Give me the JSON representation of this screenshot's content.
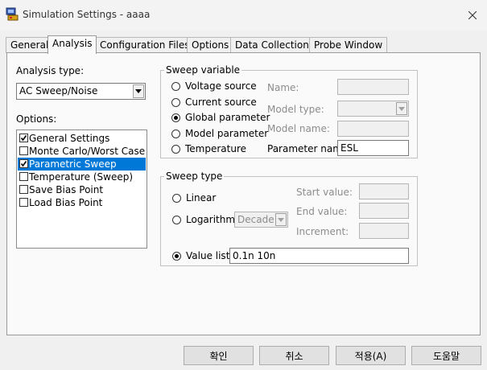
{
  "window": {
    "title": "Simulation Settings - aaaa"
  },
  "tabs": [
    {
      "label": "General"
    },
    {
      "label": "Analysis"
    },
    {
      "label": "Configuration Files"
    },
    {
      "label": "Options"
    },
    {
      "label": "Data Collection"
    },
    {
      "label": "Probe Window"
    }
  ],
  "analysis": {
    "type_label": "Analysis type:",
    "type_value": "AC Sweep/Noise",
    "options_label": "Options:",
    "options": [
      {
        "label": "General Settings",
        "checked": true
      },
      {
        "label": "Monte Carlo/Worst Case",
        "checked": false
      },
      {
        "label": "Parametric Sweep",
        "checked": true,
        "selected": true
      },
      {
        "label": "Temperature (Sweep)",
        "checked": false
      },
      {
        "label": "Save Bias Point",
        "checked": false
      },
      {
        "label": "Load Bias Point",
        "checked": false
      }
    ]
  },
  "sweep_variable": {
    "title": "Sweep variable",
    "options": [
      {
        "label": "Voltage source",
        "selected": false
      },
      {
        "label": "Current source",
        "selected": false
      },
      {
        "label": "Global parameter",
        "selected": true
      },
      {
        "label": "Model parameter",
        "selected": false
      },
      {
        "label": "Temperature",
        "selected": false
      }
    ],
    "name_label": "Name:",
    "model_type_label": "Model type:",
    "model_name_label": "Model name:",
    "parameter_name_label": "Parameter name:",
    "parameter_name_value": "ESL"
  },
  "sweep_type": {
    "title": "Sweep type",
    "linear_label": "Linear",
    "logarithmic_label": "Logarithmic",
    "log_scale_value": "Decade",
    "value_list_label": "Value list",
    "value_list_value": "0.1n 10n",
    "selected": "value_list",
    "start_label": "Start value:",
    "end_label": "End value:",
    "increment_label": "Increment:"
  },
  "buttons": {
    "ok": "확인",
    "cancel": "취소",
    "apply": "적용(A)",
    "help": "도움말"
  },
  "colors": {
    "selection": "#0078d7",
    "disabled_text": "#8c8c8c"
  }
}
